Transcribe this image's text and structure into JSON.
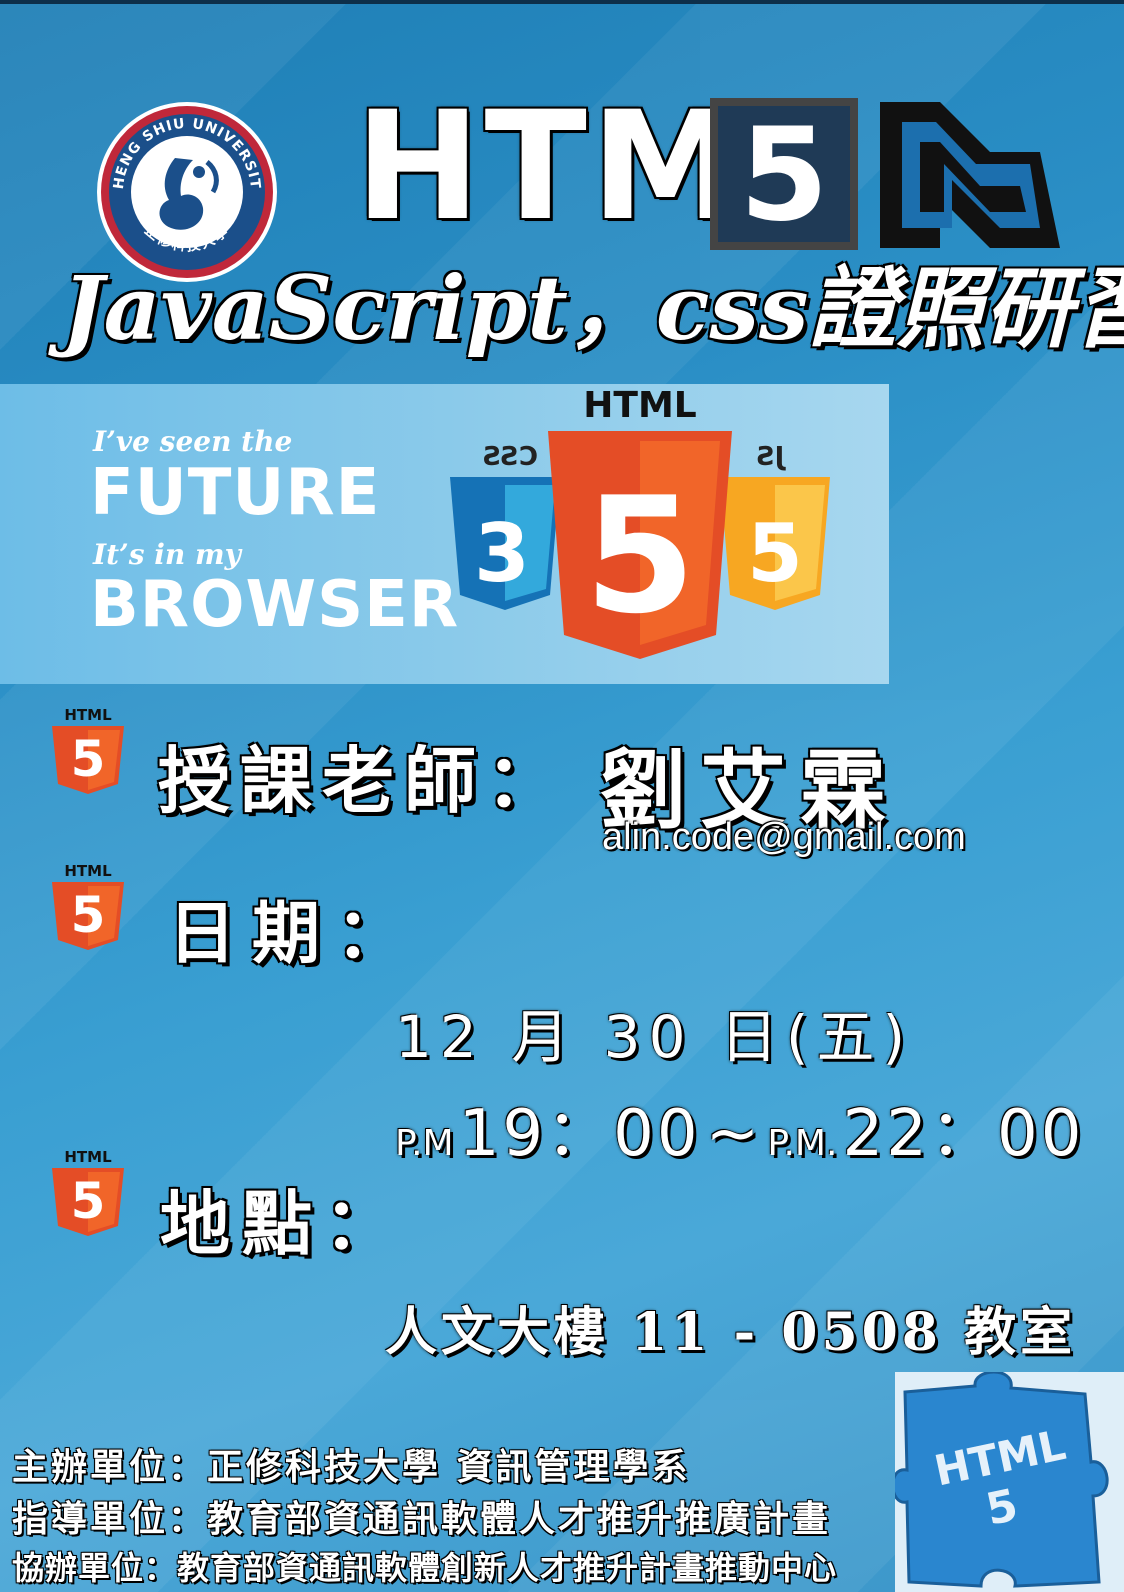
{
  "logo": {
    "ring_text": "CHENG SHIU UNIVERSITY",
    "chinese_text": "正修科技大學"
  },
  "title": {
    "html": "HTML",
    "five": "5",
    "subtitle": "JavaScript，css證照研習"
  },
  "banner": {
    "line1": "I’ve seen the",
    "line2": "FUTURE",
    "line3": "It’s in my",
    "line4": "BROWSER",
    "shield_top": "HTML",
    "css_label": "CSS",
    "js_label": "JS",
    "css_num": "3",
    "html_num": "5",
    "js_num": "5"
  },
  "badge": {
    "label": "HTML",
    "num": "5"
  },
  "info": {
    "teacher_label": "授課老師：",
    "teacher_name": "劉艾霖",
    "email": "alin.code@gmail.com",
    "date_label": "日期：",
    "date_value": "12 月 30 日(五)",
    "time_pm1": "P.M",
    "time_start": "19：00",
    "time_sep": "~",
    "time_pm2": "P.M.",
    "time_end": "22：00",
    "location_label": "地點：",
    "location_value": "人文大樓 11 - 0508 教室"
  },
  "organizers": {
    "host": "主辦單位：正修科技大學 資訊管理學系",
    "guide": "指導單位：教育部資通訊軟體人才推升推廣計畫",
    "co_host": "協辦單位：教育部資通訊軟體創新人才推升計畫推動中心"
  },
  "puzzle": {
    "line1": "HTML",
    "line2": "5"
  },
  "colors": {
    "html5_orange": "#e44d26",
    "html5_orange_light": "#f16529",
    "css_blue": "#1572b6",
    "js_yellow": "#f7a722",
    "logo_red": "#c0283a",
    "logo_navy": "#1b4f8a"
  }
}
